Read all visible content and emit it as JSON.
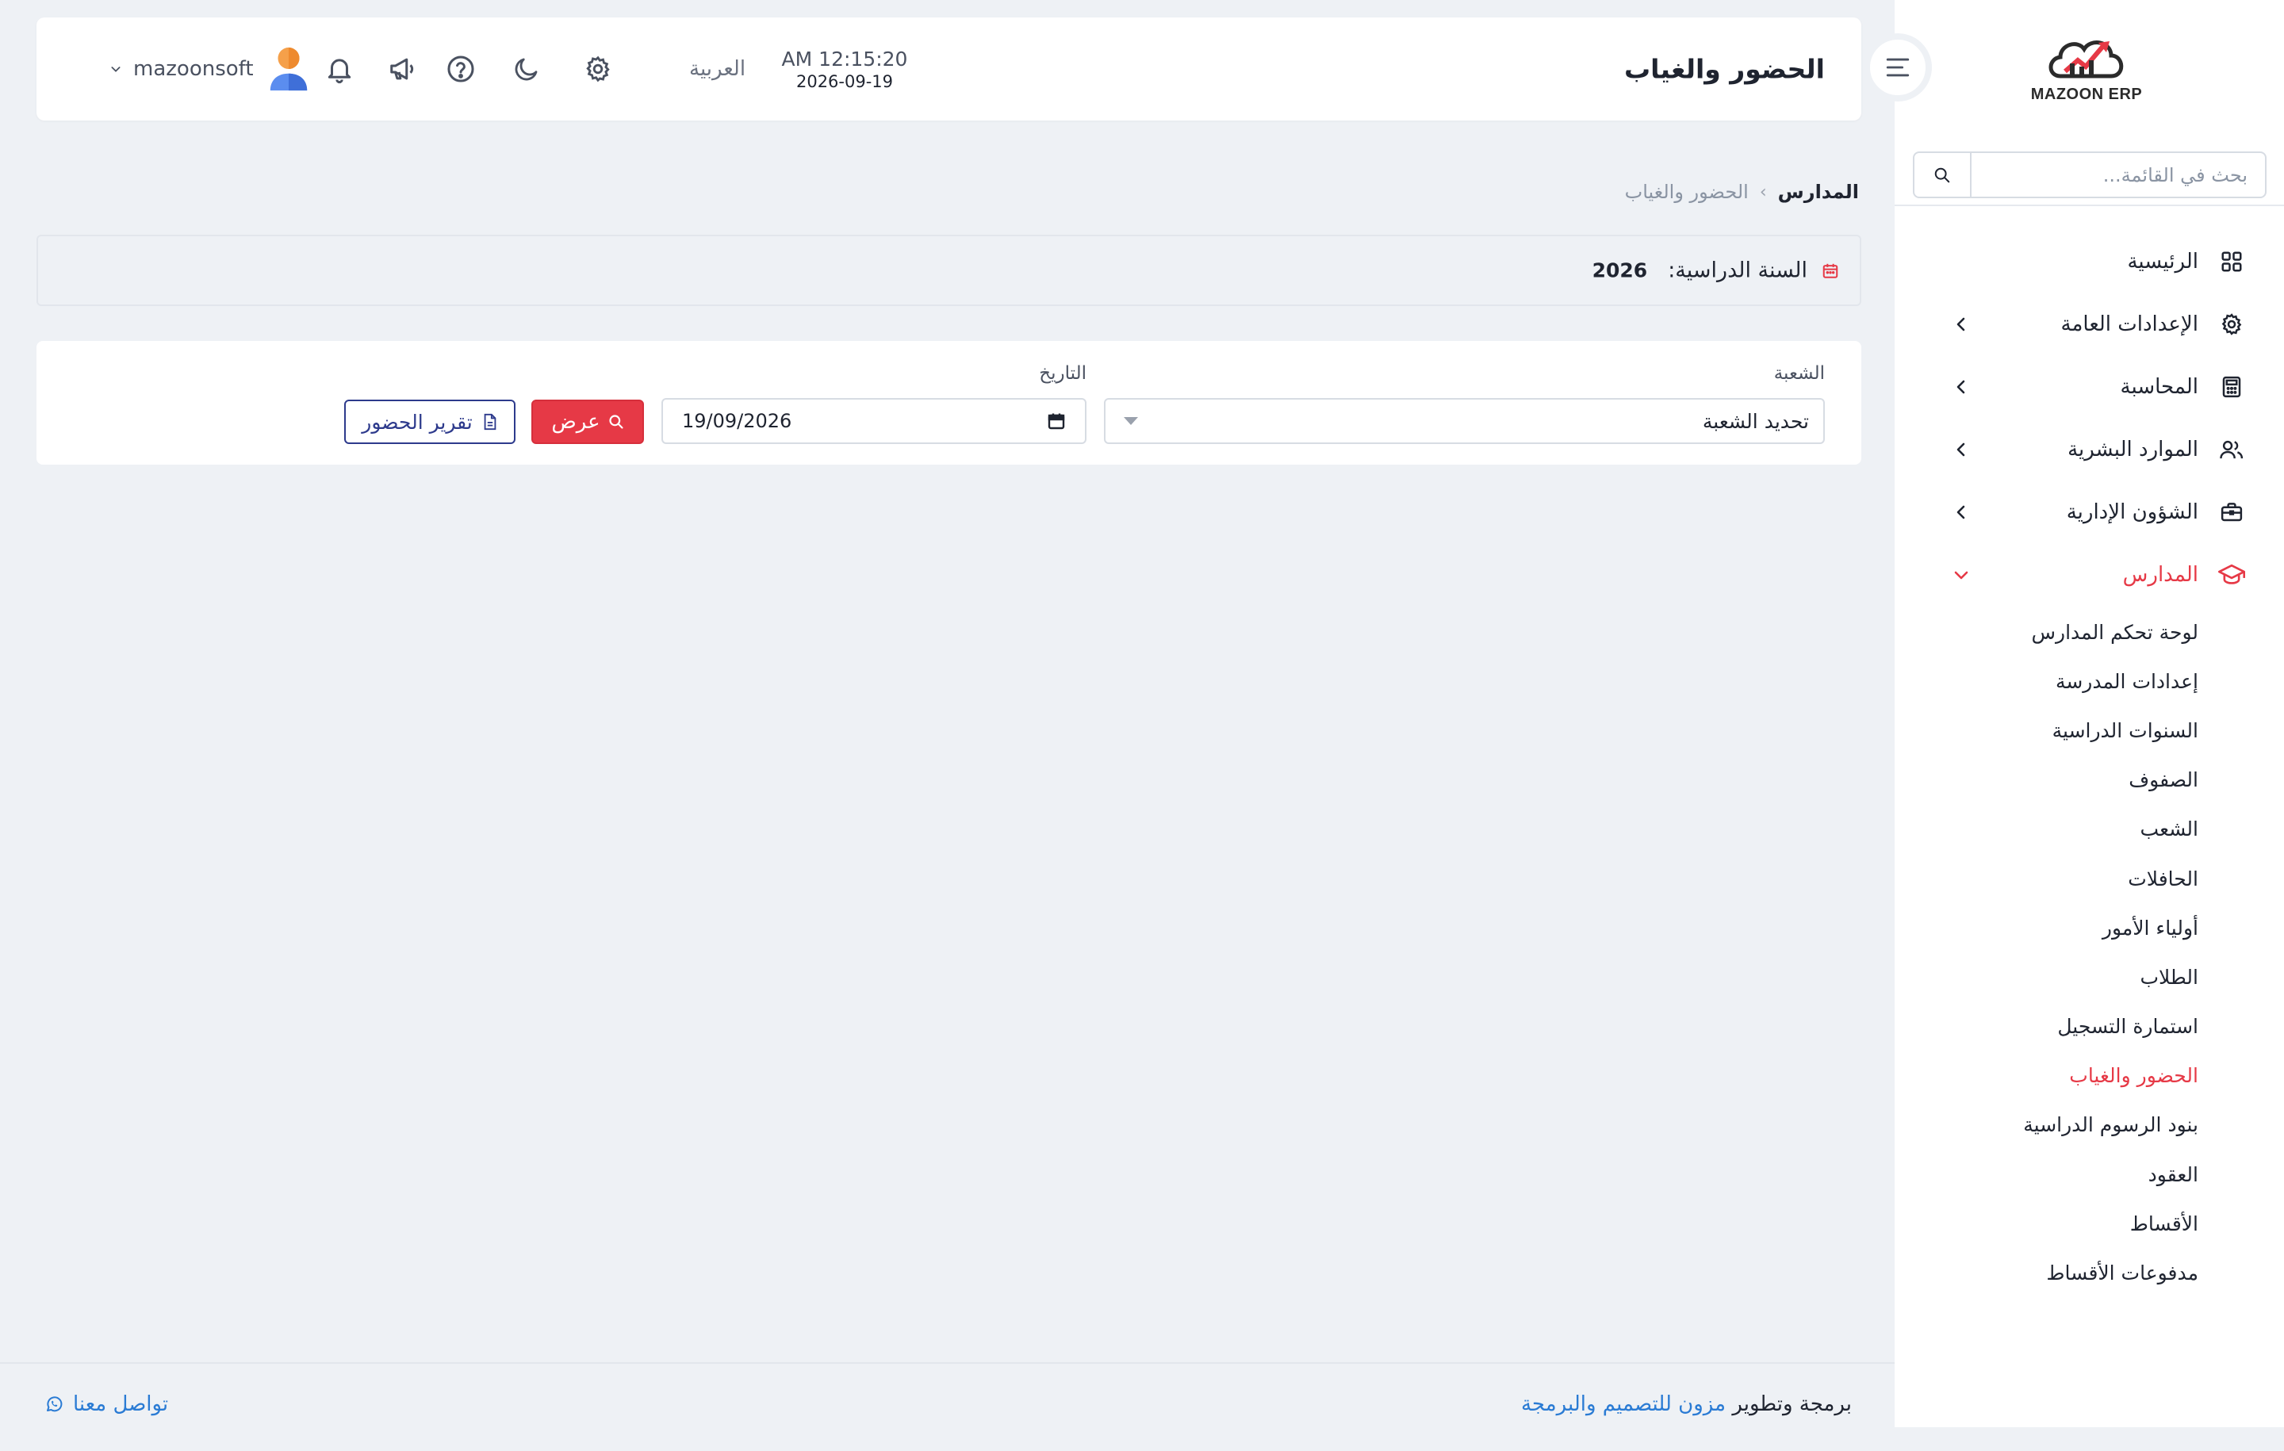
{
  "brand": {
    "name": "MAZOON ERP",
    "accent": "#e63946",
    "link_color": "#2a7bd4"
  },
  "header": {
    "title": "الحضور والغياب",
    "time": "AM 12:15:20",
    "date": "2026-09-19",
    "language": "العربية",
    "username": "mazoonsoft",
    "icons": [
      "settings-icon",
      "moon-icon",
      "help-icon",
      "megaphone-icon",
      "bell-icon"
    ]
  },
  "sidebar": {
    "search_placeholder": "بحث في القائمة...",
    "items": [
      {
        "label": "الرئيسية",
        "icon": "grid-icon",
        "has_children": false
      },
      {
        "label": "الإعدادات العامة",
        "icon": "gear-icon",
        "has_children": true
      },
      {
        "label": "المحاسبة",
        "icon": "calculator-icon",
        "has_children": true
      },
      {
        "label": "الموارد البشرية",
        "icon": "users-icon",
        "has_children": true
      },
      {
        "label": "الشؤون الإدارية",
        "icon": "briefcase-icon",
        "has_children": true
      },
      {
        "label": "المدارس",
        "icon": "graduation-cap-icon",
        "has_children": true,
        "expanded": true
      }
    ],
    "schools_sub": [
      "لوحة تحكم المدارس",
      "إعدادات المدرسة",
      "السنوات الدراسية",
      "الصفوف",
      "الشعب",
      "الحافلات",
      "أولياء الأمور",
      "الطلاب",
      "استمارة التسجيل",
      "الحضور والغياب",
      "بنود الرسوم الدراسية",
      "العقود",
      "الأقساط",
      "مدفوعات الأقساط"
    ],
    "active_sub": "الحضور والغياب"
  },
  "breadcrumb": {
    "root": "المدارس",
    "separator": "›",
    "current": "الحضور والغياب"
  },
  "academic_year": {
    "label": "السنة الدراسية:",
    "value": "2026"
  },
  "filters": {
    "section_label": "الشعبة",
    "section_value": "تحديد الشعبة",
    "date_label": "التاريخ",
    "date_value": "19/09/2026",
    "show_label": "عرض",
    "report_label": "تقرير الحضور"
  },
  "footer": {
    "credit_prefix": "برمجة وتطوير",
    "credit_link": "مزون للتصميم والبرمجة",
    "contact_label": "تواصل معنا"
  }
}
